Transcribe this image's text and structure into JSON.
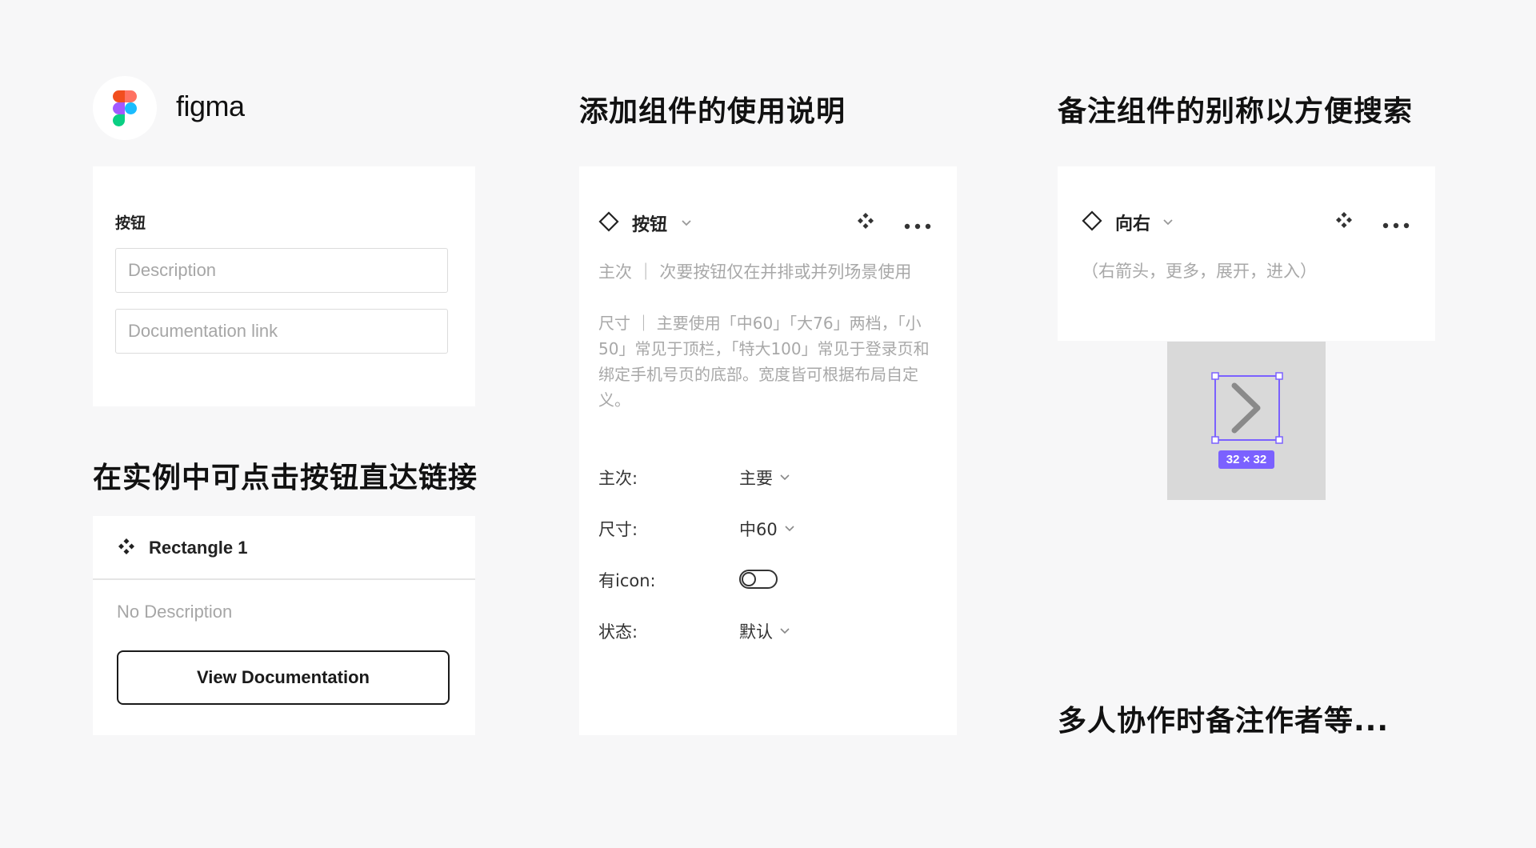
{
  "brand": {
    "name": "figma",
    "colors": [
      "#f24e1e",
      "#ff7262",
      "#a259ff",
      "#1abcfe",
      "#0acf83"
    ]
  },
  "doc_panel": {
    "label": "按钮",
    "description_placeholder": "Description",
    "doclink_placeholder": "Documentation link"
  },
  "sections": {
    "link_heading": "在实例中可点击按钮直达链接",
    "usage_heading": "添加组件的使用说明",
    "alias_heading": "备注组件的别称以方便搜索",
    "collab_heading": "多人协作时备注作者等..."
  },
  "instance_panel": {
    "title": "Rectangle 1",
    "no_description": "No Description",
    "view_button": "View Documentation"
  },
  "usage_panel": {
    "title": "按钮",
    "desc_line1": "主次 ｜ 次要按钮仅在并排或并列场景使用",
    "desc_line2": "尺寸 ｜ 主要使用「中60」「大76」两档，「小50」常见于顶栏，「特大100」常见于登录页和绑定手机号页的底部。宽度皆可根据布局自定义。",
    "props": [
      {
        "label": "主次:",
        "value": "主要"
      },
      {
        "label": "尺寸:",
        "value": "中60"
      },
      {
        "label": "有icon:",
        "toggle_on": false
      },
      {
        "label": "状态:",
        "value": "默认"
      }
    ]
  },
  "alias_panel": {
    "title": "向右",
    "aliases": "（右箭头，更多，展开，进入）",
    "size_badge": "32 × 32",
    "selection_color": "#7b61ff"
  },
  "icons": [
    "figma-logo-icon",
    "component-icon",
    "chevron-down-icon",
    "more-icon",
    "chevron-right-icon"
  ]
}
